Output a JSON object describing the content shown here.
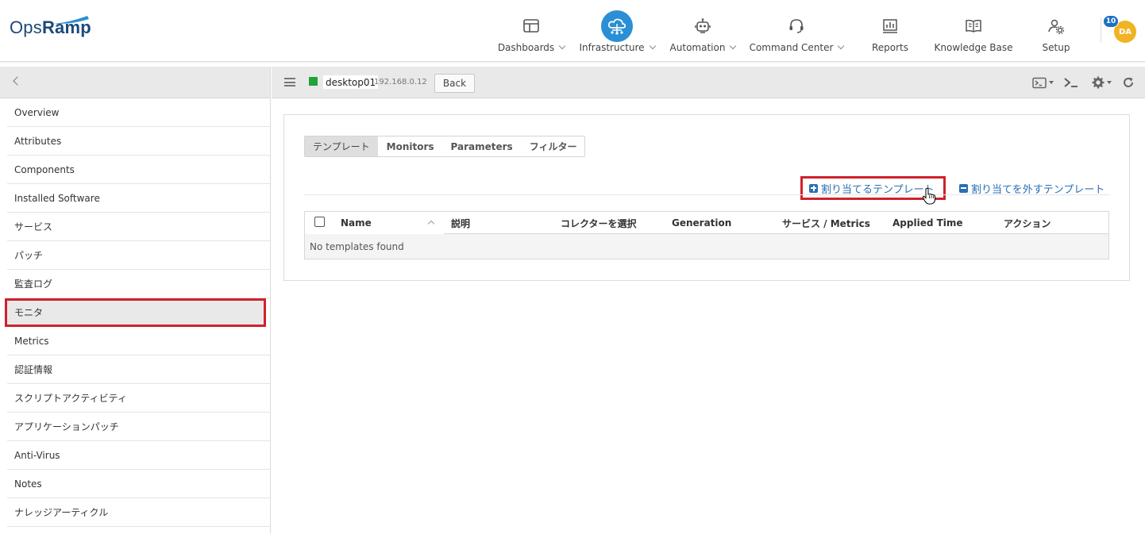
{
  "brand": {
    "logo_part1": "Ops",
    "logo_part2": "Ramp"
  },
  "nav": [
    {
      "label": "Dashboards",
      "icon": "dashboard-icon",
      "has_menu": true
    },
    {
      "label": "Infrastructure",
      "icon": "cloud-network-icon",
      "has_menu": true,
      "active": true
    },
    {
      "label": "Automation",
      "icon": "robot-icon",
      "has_menu": true
    },
    {
      "label": "Command Center",
      "icon": "headset-icon",
      "has_menu": true
    },
    {
      "label": "Reports",
      "icon": "report-icon",
      "has_menu": false
    },
    {
      "label": "Knowledge Base",
      "icon": "book-icon",
      "has_menu": false
    },
    {
      "label": "Setup",
      "icon": "user-gear-icon",
      "has_menu": false
    }
  ],
  "user": {
    "initials": "DA",
    "notifications": "10"
  },
  "sidebar": {
    "items": [
      {
        "label": "Overview"
      },
      {
        "label": "Attributes"
      },
      {
        "label": "Components"
      },
      {
        "label": "Installed Software"
      },
      {
        "label": "サービス"
      },
      {
        "label": "パッチ"
      },
      {
        "label": "監査ログ"
      },
      {
        "label": "モニタ",
        "active": true
      },
      {
        "label": "Metrics"
      },
      {
        "label": "認証情報"
      },
      {
        "label": "スクリプトアクティビティ"
      },
      {
        "label": "アプリケーションパッチ"
      },
      {
        "label": "Anti-Virus"
      },
      {
        "label": "Notes"
      },
      {
        "label": "ナレッジアーティクル"
      }
    ]
  },
  "resource": {
    "name": "desktop01",
    "ip": "192.168.0.12",
    "status_color": "#21a336",
    "back_label": "Back"
  },
  "tabs": [
    {
      "label": "テンプレート",
      "active": true
    },
    {
      "label": "Monitors"
    },
    {
      "label": "Parameters"
    },
    {
      "label": "フィルター"
    }
  ],
  "actions": {
    "assign_label": "割り当てるテンプレート",
    "unassign_label": "割り当てを外すテンプレート"
  },
  "table": {
    "columns": [
      "Name",
      "説明",
      "コレクターを選択",
      "Generation",
      "サービス / Metrics",
      "Applied Time",
      "アクション"
    ],
    "empty_message": "No templates found"
  },
  "colors": {
    "accent": "#2a8fd4",
    "highlight": "#d0222c",
    "link": "#2a6fb4",
    "avatar": "#f0b323"
  }
}
